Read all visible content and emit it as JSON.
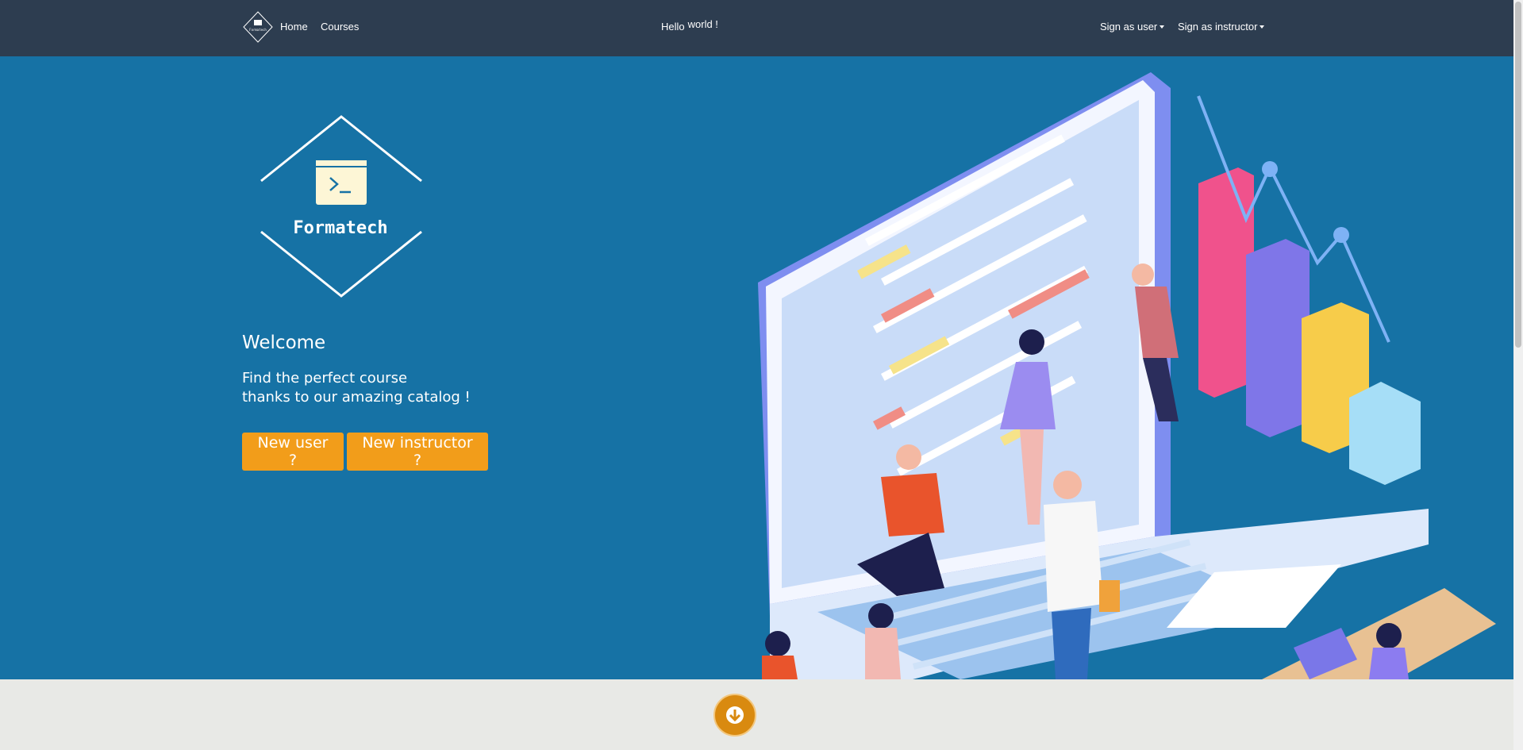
{
  "nav": {
    "logo_icon": "formatech-logo-icon",
    "logo_text": "Formatech",
    "home": "Home",
    "courses": "Courses",
    "hello_1": "Hello",
    "hello_2": "world !",
    "sign_user": "Sign as user",
    "sign_instructor": "Sign as instructor"
  },
  "hero": {
    "logo_text": "Formatech",
    "welcome": "Welcome",
    "tagline_1": "Find the perfect course",
    "tagline_2": "thanks to our amazing catalog !",
    "btn_user": "New user ?",
    "btn_instructor": "New instructor ?"
  },
  "footer": {
    "scroll_icon": "arrow-down-icon"
  },
  "colors": {
    "navbar": "#2d3d50",
    "hero": "#1672a5",
    "accent": "#f29d1a",
    "footer": "#e8e9e6"
  }
}
